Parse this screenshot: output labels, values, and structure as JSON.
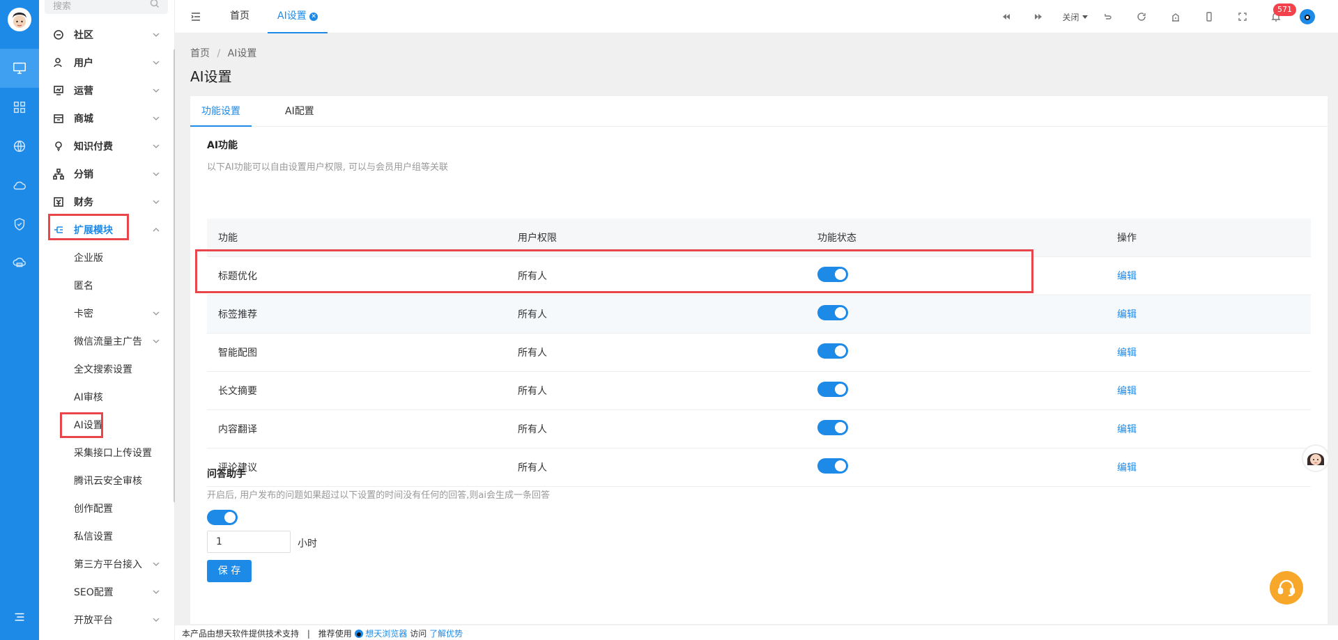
{
  "sidebar": {
    "search_placeholder": "搜索",
    "items": [
      {
        "label": "社区"
      },
      {
        "label": "用户"
      },
      {
        "label": "运营"
      },
      {
        "label": "商城"
      },
      {
        "label": "知识付费"
      },
      {
        "label": "分销"
      },
      {
        "label": "财务"
      },
      {
        "label": "扩展模块"
      }
    ],
    "sub_items": [
      {
        "label": "企业版"
      },
      {
        "label": "匿名"
      },
      {
        "label": "卡密"
      },
      {
        "label": "微信流量主广告"
      },
      {
        "label": "全文搜索设置"
      },
      {
        "label": "AI审核"
      },
      {
        "label": "AI设置"
      },
      {
        "label": "采集接口上传设置"
      },
      {
        "label": "腾讯云安全审核"
      },
      {
        "label": "创作配置"
      },
      {
        "label": "私信设置"
      },
      {
        "label": "第三方平台接入"
      },
      {
        "label": "SEO配置"
      },
      {
        "label": "开放平台"
      }
    ]
  },
  "topbar": {
    "tab_home": "首页",
    "tab_ai": "AI设置",
    "close_label": "关闭",
    "badge_count": "571"
  },
  "breadcrumb": {
    "home": "首页",
    "sep": "/",
    "current": "AI设置"
  },
  "page_title": "AI设置",
  "card": {
    "tab1": "功能设置",
    "tab2": "AI配置",
    "ai_title": "AI功能",
    "ai_desc": "以下AI功能可以自由设置用户权限, 可以与会员用户组等关联",
    "columns": [
      "功能",
      "用户权限",
      "功能状态",
      "操作"
    ],
    "rows": [
      {
        "name": "标题优化",
        "perm": "所有人",
        "action": "编辑"
      },
      {
        "name": "标签推荐",
        "perm": "所有人",
        "action": "编辑"
      },
      {
        "name": "智能配图",
        "perm": "所有人",
        "action": "编辑"
      },
      {
        "name": "长文摘要",
        "perm": "所有人",
        "action": "编辑"
      },
      {
        "name": "内容翻译",
        "perm": "所有人",
        "action": "编辑"
      },
      {
        "name": "评论建议",
        "perm": "所有人",
        "action": "编辑"
      }
    ],
    "qa_title": "问答助手",
    "qa_desc": "开启后, 用户发布的问题如果超过以下设置的时间没有任何的回答,则ai会生成一条回答",
    "hours_value": "1",
    "hours_unit": "小时",
    "save_label": "保 存"
  },
  "footer": {
    "text1": "本产品由想天软件提供技术支持",
    "sep": "|",
    "text2": "推荐使用",
    "browser": "想天浏览器",
    "text3": "访问",
    "advantage": "了解优势"
  },
  "colors": {
    "accent": "#1e8ae8",
    "highlight": "#e8464b"
  }
}
